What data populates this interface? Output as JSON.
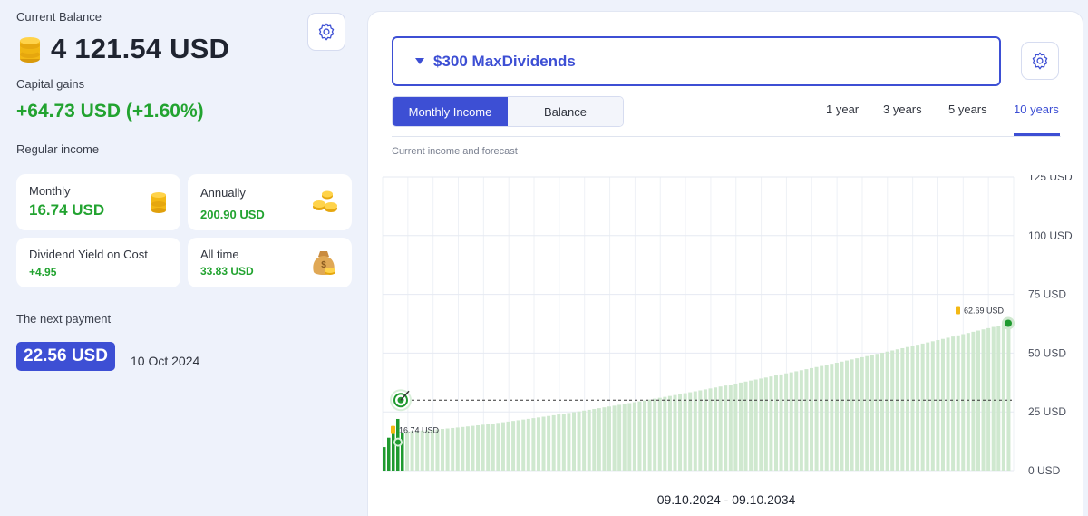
{
  "balance": {
    "label": "Current Balance",
    "amount": "4 121.54 USD"
  },
  "capital": {
    "label": "Capital gains",
    "value": "+64.73 USD (+1.60%)"
  },
  "income": {
    "label": "Regular income",
    "monthly": {
      "label": "Monthly",
      "value": "16.74 USD"
    },
    "annually": {
      "label": "Annually",
      "value": "200.90 USD"
    },
    "yield": {
      "label": "Dividend Yield on Cost",
      "value": "+4.95"
    },
    "alltime": {
      "label": "All time",
      "value": "33.83 USD"
    }
  },
  "next_payment": {
    "label": "The next payment",
    "amount": "22.56 USD",
    "date": "10 Oct 2024"
  },
  "portfolio": {
    "name": "$300 MaxDividends"
  },
  "view_tabs": [
    "Monthly Income",
    "Balance"
  ],
  "periods": [
    "1 year",
    "3 years",
    "5 years",
    "10 years"
  ],
  "active_period": "10 years",
  "chart_caption": "Current income and forecast",
  "date_range": "09.10.2024 - 09.10.2034",
  "colors": {
    "accent": "#3d4fd4",
    "positive": "#22a330",
    "forecast_bar": "#cfe8cf",
    "history_bar": "#1f9a2f"
  },
  "icons": {
    "coin": "coin-stack-icon",
    "coins": "coins-icon",
    "moneybag": "money-bag-icon",
    "settings": "gear-icon",
    "target": "target-icon"
  },
  "chart_data": {
    "type": "bar",
    "ylabel_unit": "USD",
    "ylim": [
      0,
      125
    ],
    "yticks": [
      "0 USD",
      "25 USD",
      "50 USD",
      "75 USD",
      "100 USD",
      "125 USD"
    ],
    "history": [
      10,
      14,
      17,
      22,
      16
    ],
    "forecast_start": 16.74,
    "forecast_end": 62.69,
    "forecast_count": 120,
    "target_line": 30,
    "start_label": "16.74 USD",
    "end_label": "62.69 USD",
    "grid": true
  }
}
